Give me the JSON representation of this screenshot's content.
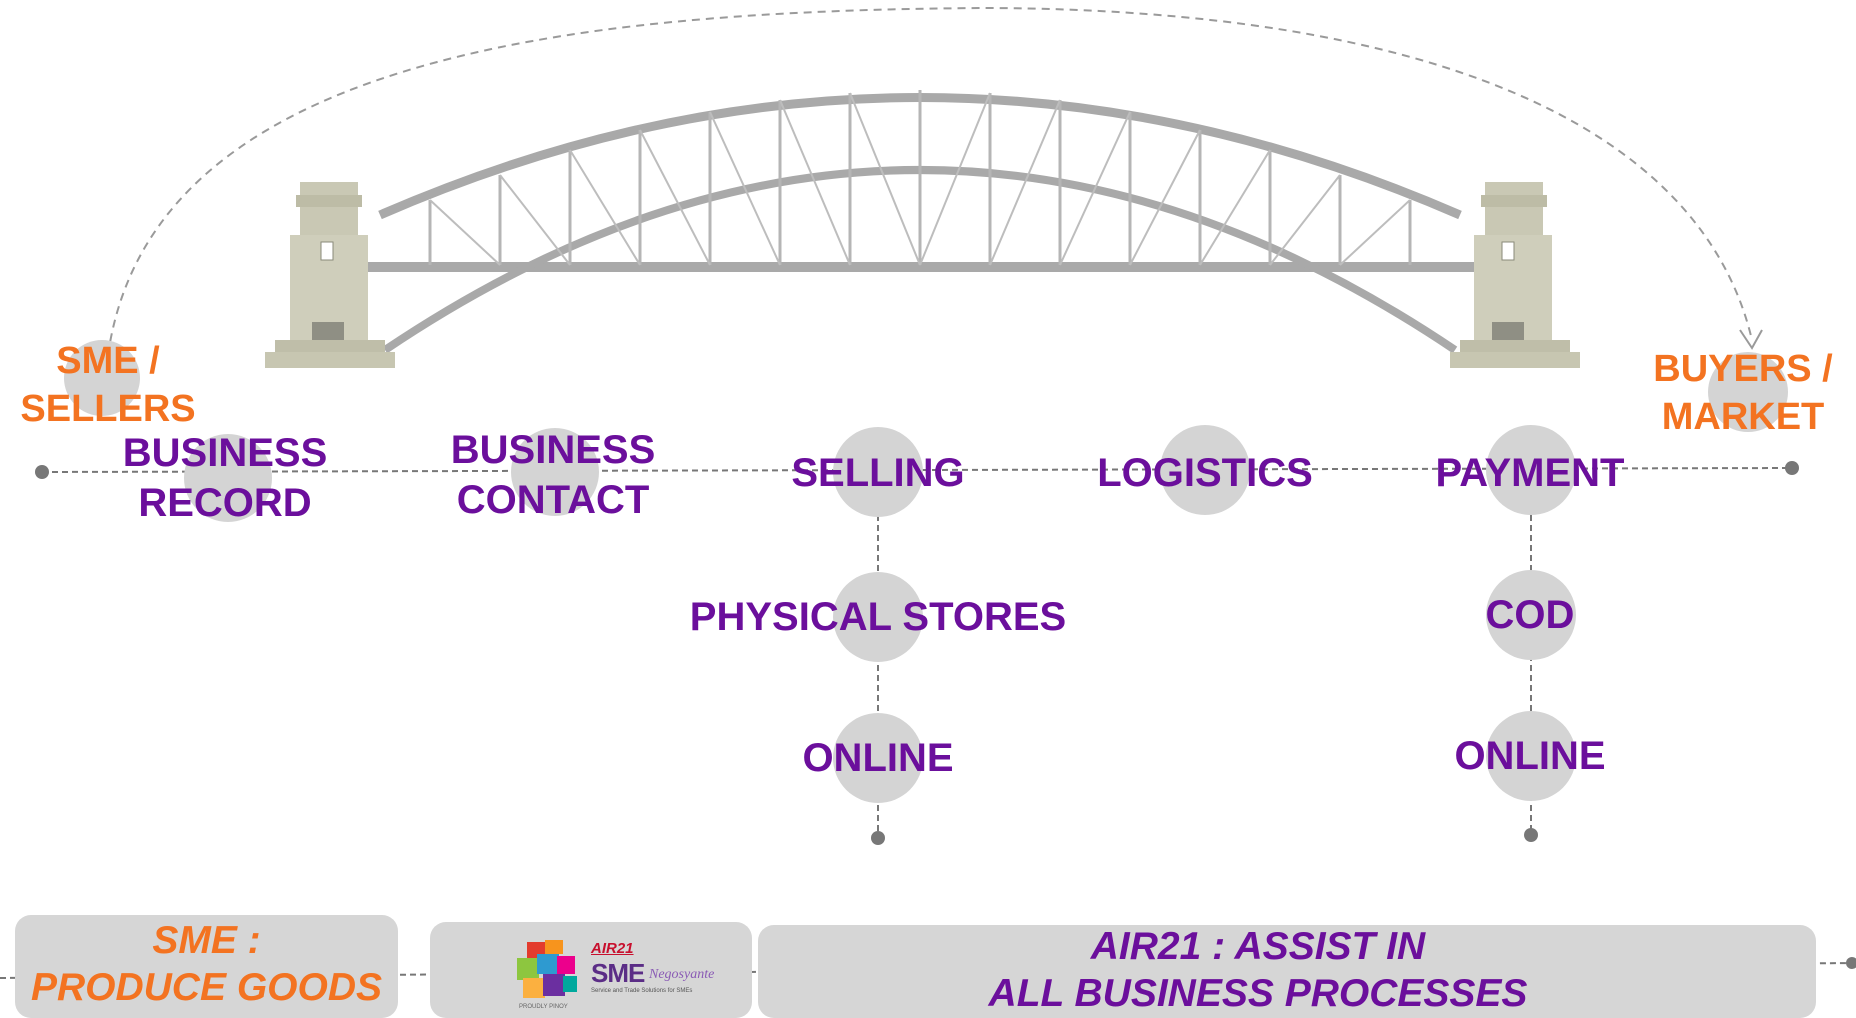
{
  "endpoints": {
    "sellers": "SME /\nSELLERS",
    "buyers": "BUYERS /\nMARKET"
  },
  "main_steps": [
    "BUSINESS\nRECORD",
    "BUSINESS\nCONTACT",
    "SELLING",
    "LOGISTICS",
    "PAYMENT"
  ],
  "selling_branch": [
    "PHYSICAL STORES",
    "ONLINE"
  ],
  "payment_branch": [
    "COD",
    "ONLINE"
  ],
  "footer": {
    "sme_box": "SME :\nPRODUCE GOODS",
    "air21_box": "AIR21 : ASSIST IN\nALL BUSINESS PROCESSES",
    "logo": {
      "brand": "AIR21",
      "name": "SME",
      "name_suffix": "Negosyante",
      "tagline": "Service and Trade Solutions for SMEs",
      "badge": "PROUDLY PINOY"
    }
  },
  "colors": {
    "step_text": "#6b0f9c",
    "endpoint_text": "#f37321",
    "node_circle": "#d4d4d4",
    "line": "#777777",
    "box_fill": "#d6d6d6"
  }
}
